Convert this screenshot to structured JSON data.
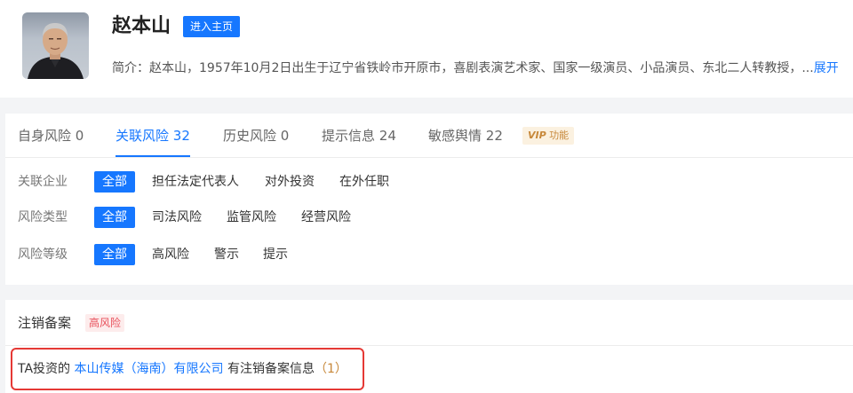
{
  "profile": {
    "name": "赵本山",
    "home_button": "进入主页",
    "intro_prefix": "简介：",
    "intro_text": "赵本山，1957年10月2日出生于辽宁省铁岭市开原市，喜剧表演艺术家、国家一级演员、小品演员、东北二人转教授，...",
    "expand_label": "展开"
  },
  "tabs": [
    {
      "label": "自身风险",
      "count": "0"
    },
    {
      "label": "关联风险",
      "count": "32",
      "active": true
    },
    {
      "label": "历史风险",
      "count": "0"
    },
    {
      "label": "提示信息",
      "count": "24"
    },
    {
      "label": "敏感舆情",
      "count": "22"
    }
  ],
  "vip": {
    "tag": "VIP",
    "label": "功能"
  },
  "filters": {
    "related_company": {
      "label": "关联企业",
      "options": [
        "全部",
        "担任法定代表人",
        "对外投资",
        "在外任职"
      ]
    },
    "risk_type": {
      "label": "风险类型",
      "options": [
        "全部",
        "司法风险",
        "监管风险",
        "经营风险"
      ]
    },
    "risk_level": {
      "label": "风险等级",
      "options": [
        "全部",
        "高风险",
        "警示",
        "提示"
      ]
    }
  },
  "cancel_record": {
    "title": "注销备案",
    "badge": "高风险",
    "prefix": "TA投资的",
    "company": "本山传媒（海南）有限公司",
    "suffix": "有注销备案信息",
    "count": "（1）"
  },
  "colors": {
    "accent": "#1677ff",
    "high_risk": "#e8505b",
    "highlight_border": "#e53935",
    "vip": "#c7883a"
  }
}
